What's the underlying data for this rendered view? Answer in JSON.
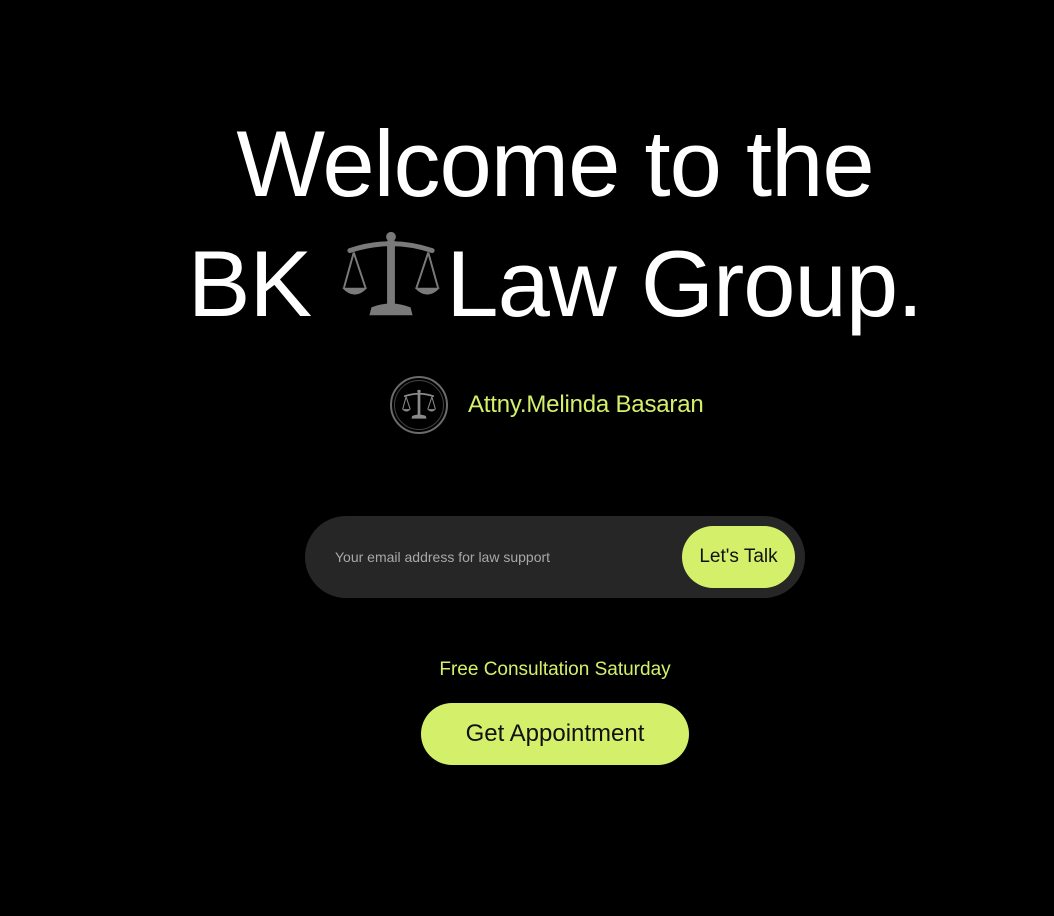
{
  "hero": {
    "line1": "Welcome to the",
    "line2_before": "BK",
    "line2_after": "Law Group.",
    "inline_icon": "balance-scale-icon"
  },
  "attorney": {
    "name": "Attny.Melinda Basaran",
    "avatar_icon": "balance-scale-icon"
  },
  "contact": {
    "email_value": "",
    "email_placeholder": "Your email address for law support",
    "submit_label": "Let's Talk"
  },
  "appointment": {
    "note": "Free Consultation Saturday",
    "button_label": "Get Appointment"
  },
  "colors": {
    "background": "#000000",
    "accent": "#d4f06b",
    "field_bg": "#262626",
    "headline": "#ffffff"
  }
}
